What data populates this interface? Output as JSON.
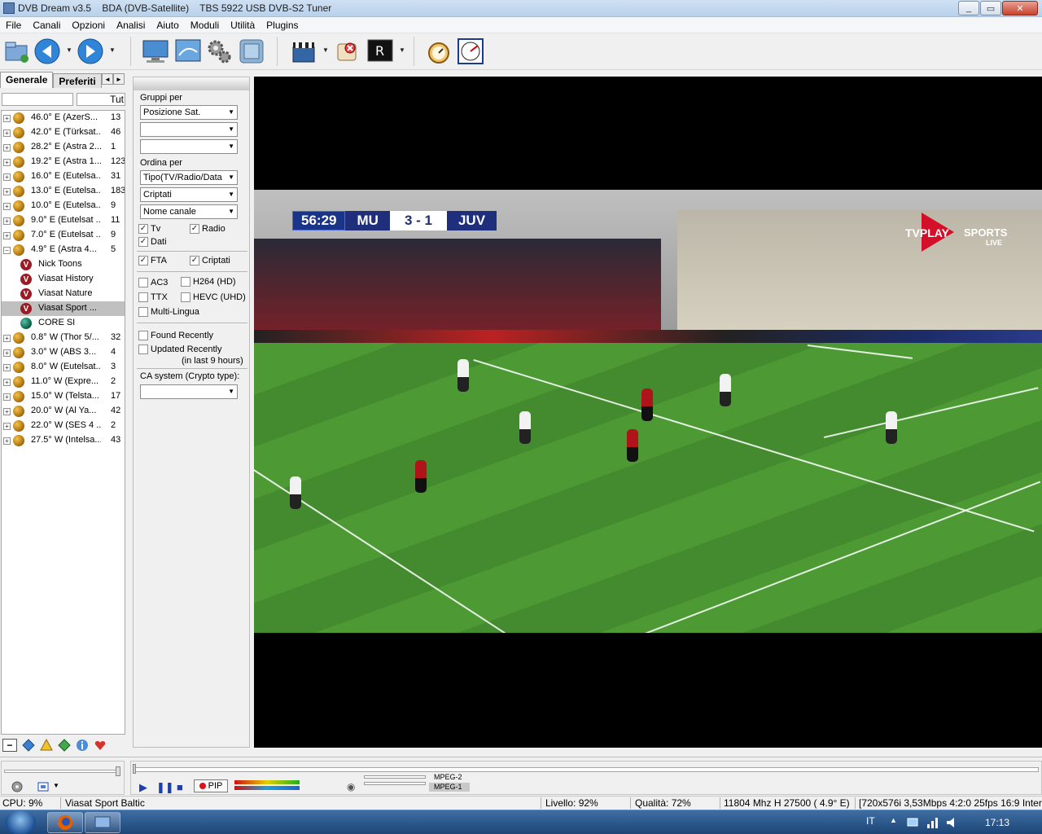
{
  "window": {
    "title": "DVB Dream v3.5    BDA (DVB-Satellite)    TBS 5922 USB DVB-S2 Tuner",
    "minimize": "_",
    "maximize": "▭",
    "close": "✕"
  },
  "menu": [
    "File",
    "Canali",
    "Opzioni",
    "Analisi",
    "Aiuto",
    "Moduli",
    "Utilità",
    "Plugins"
  ],
  "toolbar": {
    "icons": [
      "open-folder-icon",
      "back-icon",
      "forward-icon",
      "monitor-icon",
      "screen-icon",
      "settings-gear-icon",
      "satellite-dish-icon",
      "clapperboard-icon",
      "scroll-icon",
      "record-icon",
      "stopwatch-icon",
      "clock-icon"
    ],
    "drop": "▼"
  },
  "left_panel": {
    "tabs": [
      "Generale",
      "Preferiti"
    ],
    "tab_arrows": [
      "◄",
      "►"
    ],
    "filter_value": "",
    "filter_all": "Tut",
    "expand_symbol": "+",
    "collapse_symbol": "−",
    "channel_logo_letter": "V",
    "satellites_top": [
      {
        "name": "46.0° E (AzerS...",
        "count": "13"
      },
      {
        "name": "42.0° E (Türksat...",
        "count": "46"
      },
      {
        "name": "28.2° E (Astra 2...",
        "count": "1"
      },
      {
        "name": "19.2° E (Astra 1...",
        "count": "123"
      },
      {
        "name": "16.0° E (Eutelsa...",
        "count": "31"
      },
      {
        "name": "13.0° E (Eutelsa...",
        "count": "183"
      },
      {
        "name": "10.0° E (Eutelsa...",
        "count": "9"
      },
      {
        "name": "9.0° E (Eutelsat ...",
        "count": "11"
      },
      {
        "name": "7.0° E (Eutelsat ...",
        "count": "9"
      }
    ],
    "expanded_satellite": {
      "name": "4.9° E (Astra 4...",
      "count": "5"
    },
    "channels": [
      {
        "name": "Nick Toons",
        "selected": false
      },
      {
        "name": "Viasat History",
        "selected": false
      },
      {
        "name": "Viasat Nature",
        "selected": false
      },
      {
        "name": "Viasat Sport ...",
        "selected": true
      },
      {
        "name": "CORE SI",
        "selected": false
      }
    ],
    "satellites_bottom": [
      {
        "name": "0.8° W (Thor 5/...",
        "count": "32"
      },
      {
        "name": "3.0° W (ABS 3...",
        "count": "4"
      },
      {
        "name": "8.0° W (Eutelsat...",
        "count": "3"
      },
      {
        "name": "11.0° W (Expre...",
        "count": "2"
      },
      {
        "name": "15.0° W (Telsta...",
        "count": "17"
      },
      {
        "name": "20.0° W (Al Ya...",
        "count": "42"
      },
      {
        "name": "22.0° W (SES 4 ...",
        "count": "2"
      },
      {
        "name": "27.5° W (Intelsa...",
        "count": "43"
      }
    ],
    "bottom_minus": "−"
  },
  "filter_panel": {
    "group_label": "Gruppi per",
    "group_select": "Posizione Sat.",
    "group_select2": "",
    "group_select3": "",
    "order_label": "Ordina per",
    "order_select1": "Tipo(TV/Radio/Data",
    "order_select2": "Criptati",
    "order_select3": "Nome canale",
    "tv": "Tv",
    "radio": "Radio",
    "dati": "Dati",
    "fta": "FTA",
    "criptati": "Criptati",
    "ac3": "AC3",
    "h264": "H264 (HD)",
    "ttx": "TTX",
    "hevc": "HEVC (UHD)",
    "multilingua": "Multi-Lingua",
    "found_recently": "Found Recently",
    "updated_recently": "Updated Recently",
    "updated_hint": "(in last 9 hours)",
    "ca_label": "CA system (Crypto type):",
    "ca_select": "",
    "arrow": "▼",
    "check_mark": "✓"
  },
  "video": {
    "scorebug": {
      "time": "56:29",
      "home": "MU",
      "score": "3 - 1",
      "away": "JUV"
    },
    "brand": {
      "line1": "TVPLAY",
      "line2": "SPORTS",
      "line3": "LIVE"
    }
  },
  "controls": {
    "play": "▶",
    "pause": "❚❚",
    "stop": "■",
    "pip": "PIP",
    "codec1": "MPEG-2",
    "codec2": "MPEG-1",
    "snapshot_icon": "◉"
  },
  "status": {
    "cpu": "CPU: 9%",
    "channel": "Viasat Sport Baltic",
    "livello": "Livello: 92%",
    "qualita": "Qualità: 72%",
    "freq": "11804 Mhz  H  27500  ( 4.9° E)",
    "stream": "[720x576i  3,53Mbps 4:2:0 25fps 16:9 Interla"
  },
  "taskbar": {
    "lang": "IT",
    "time": "17:13",
    "tray_arrow": "▲"
  }
}
